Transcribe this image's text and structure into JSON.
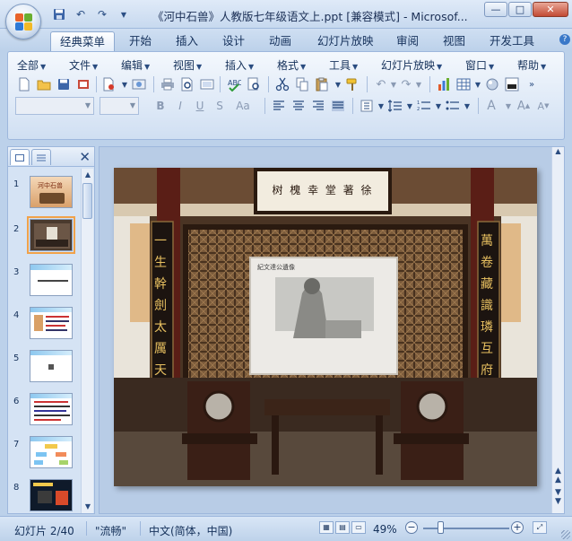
{
  "window": {
    "title": "《河中石兽》人教版七年级语文上.ppt [兼容模式] - Microsof...",
    "minimize": "—",
    "maximize": "□",
    "close": "✕"
  },
  "qat": {
    "save_icon": "save-icon",
    "undo_label": "↶",
    "redo_label": "↷",
    "more_label": "▼"
  },
  "tabs": [
    "经典菜单",
    "开始",
    "插入",
    "设计",
    "动画",
    "幻灯片放映",
    "审阅",
    "视图",
    "开发工具"
  ],
  "active_tab": 0,
  "ribbon_help": "?",
  "menu": [
    "全部",
    "文件",
    "编辑",
    "视图",
    "插入",
    "格式",
    "工具",
    "幻灯片放映",
    "窗口",
    "帮助"
  ],
  "format_buttons": [
    "B",
    "I",
    "U",
    "S",
    "Aa"
  ],
  "slides_pane": {
    "tab_slides": "slides-icon",
    "tab_outline": "outline-icon",
    "close": "✕",
    "numbers": [
      "1",
      "2",
      "3",
      "4",
      "5",
      "6",
      "7",
      "8"
    ],
    "selected": 2,
    "thumb1_text": "河中石兽"
  },
  "slide": {
    "plaque_text": "树 槐 幸 堂 著 徐",
    "couplet_left": "一生幹劍太厲天",
    "couplet_right": "萬卷藏識璘互府",
    "portrait_title": "紀文達公遺像"
  },
  "status": {
    "slide_info": "幻灯片 2/40",
    "theme": "\"流畅\"",
    "language": "中文(简体，中国)",
    "zoom": "49%",
    "zoom_level": 0.49,
    "zoom_minus": "−",
    "zoom_plus": "+"
  },
  "colors": {
    "ribbon_bg": "#dbe7f6",
    "accent_selected": "#f0a24a",
    "title_text": "#1b2f55"
  }
}
